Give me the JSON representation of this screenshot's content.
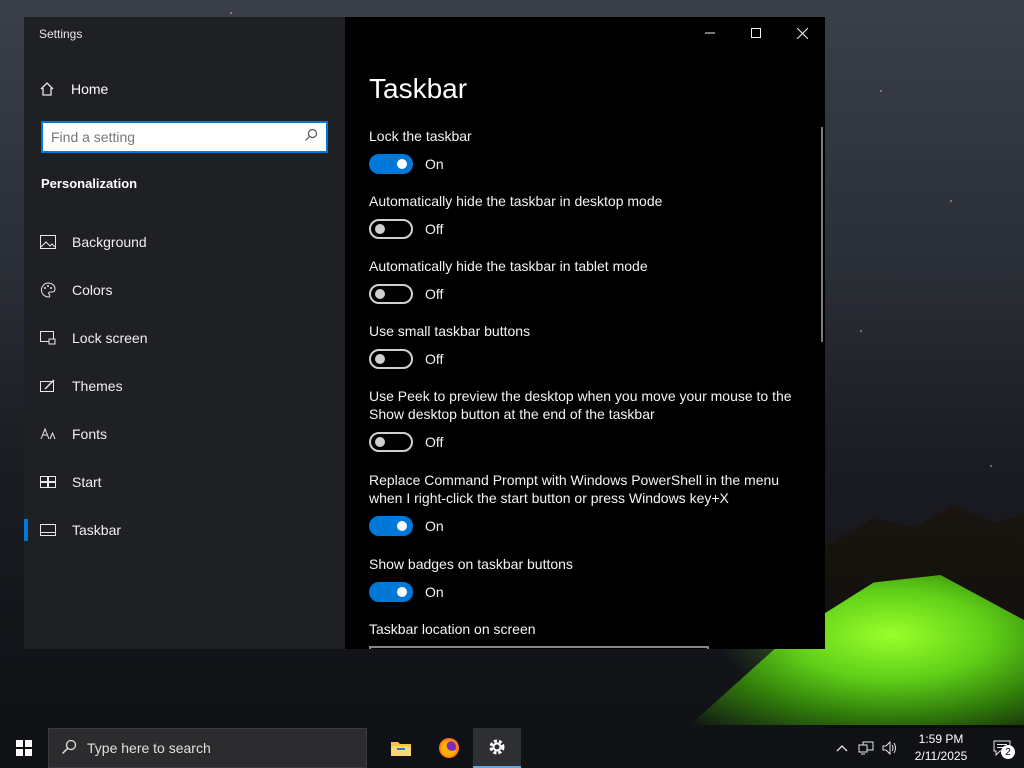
{
  "window": {
    "app_title": "Settings",
    "minimize_icon": "minimize-icon",
    "maximize_icon": "maximize-icon",
    "close_icon": "close-icon"
  },
  "sidebar": {
    "home_label": "Home",
    "search_placeholder": "Find a setting",
    "section_title": "Personalization",
    "items": [
      {
        "label": "Background",
        "icon": "picture-icon"
      },
      {
        "label": "Colors",
        "icon": "palette-icon"
      },
      {
        "label": "Lock screen",
        "icon": "lock-screen-icon"
      },
      {
        "label": "Themes",
        "icon": "themes-icon"
      },
      {
        "label": "Fonts",
        "icon": "fonts-icon"
      },
      {
        "label": "Start",
        "icon": "start-icon"
      },
      {
        "label": "Taskbar",
        "icon": "taskbar-icon",
        "active": true
      }
    ]
  },
  "main": {
    "title": "Taskbar",
    "settings": [
      {
        "label": "Lock the taskbar",
        "state": "On"
      },
      {
        "label": "Automatically hide the taskbar in desktop mode",
        "state": "Off"
      },
      {
        "label": "Automatically hide the taskbar in tablet mode",
        "state": "Off"
      },
      {
        "label": "Use small taskbar buttons",
        "state": "Off"
      },
      {
        "label": "Use Peek to preview the desktop when you move your mouse to the Show desktop button at the end of the taskbar",
        "state": "Off"
      },
      {
        "label": "Replace Command Prompt with Windows PowerShell in the menu when I right-click the start button or press Windows key+X",
        "state": "On"
      },
      {
        "label": "Show badges on taskbar buttons",
        "state": "On"
      }
    ],
    "location_label": "Taskbar location on screen"
  },
  "taskbar": {
    "search_placeholder": "Type here to search",
    "apps": [
      {
        "name": "file-explorer",
        "icon": "folder-icon"
      },
      {
        "name": "firefox",
        "icon": "firefox-icon"
      },
      {
        "name": "settings",
        "icon": "gear-icon",
        "active": true
      }
    ],
    "time": "1:59 PM",
    "date": "2/11/2025",
    "notification_count": "2"
  },
  "colors": {
    "accent": "#0078d7",
    "sidebar_bg": "#1f2023",
    "content_bg": "#000000"
  }
}
